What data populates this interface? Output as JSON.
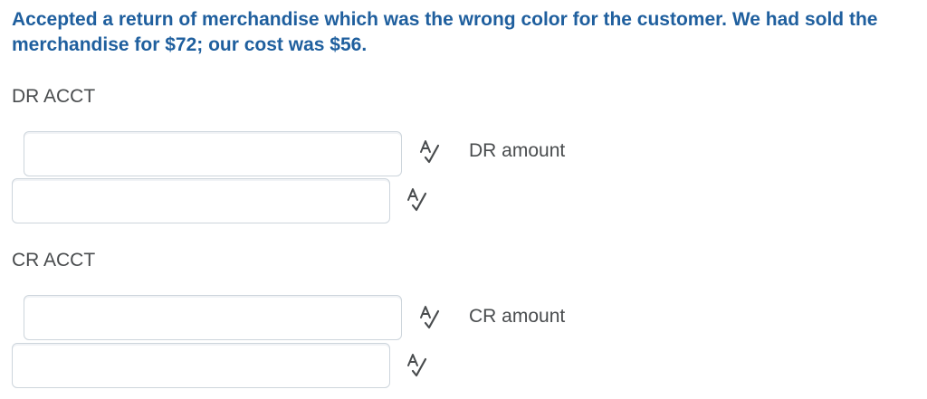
{
  "question": {
    "text": "Accepted a return of merchandise which was the wrong color for the customer. We had sold the merchandise for $72; our cost was $56."
  },
  "dr_section": {
    "label": "DR ACCT",
    "account_field": {
      "value": "",
      "placeholder": ""
    },
    "account_field_2": {
      "value": "",
      "placeholder": ""
    },
    "amount_label": "DR amount"
  },
  "cr_section": {
    "label": "CR ACCT",
    "account_field": {
      "value": "",
      "placeholder": ""
    },
    "account_field_2": {
      "value": "",
      "placeholder": ""
    },
    "amount_label": "CR amount"
  },
  "icons": {
    "spellcheck": "spellcheck-icon"
  },
  "colors": {
    "question_text": "#1f5f9e",
    "label_text": "#494c4e",
    "field_border": "#cdd5dc"
  }
}
